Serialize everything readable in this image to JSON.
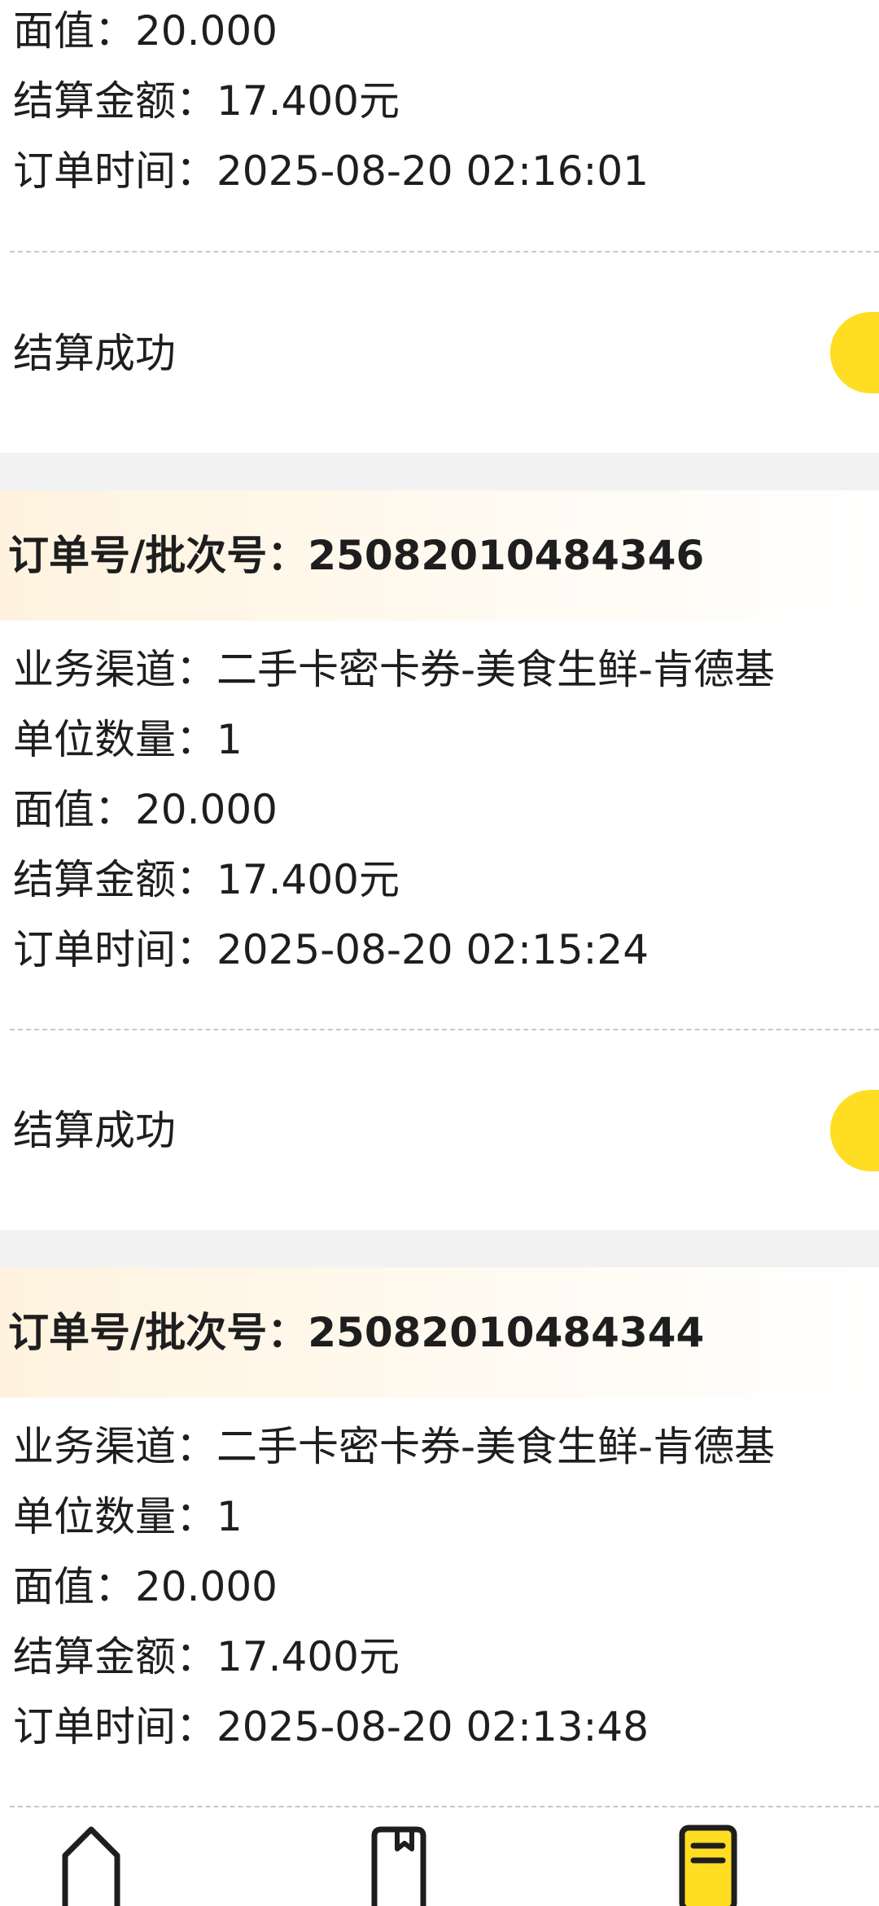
{
  "partial_order": {
    "face_value": "面值：20.000",
    "settle_amount": "结算金额：17.400元",
    "order_time": "订单时间：2025-08-20 02:16:01",
    "status": "结算成功"
  },
  "orders": [
    {
      "header": "订单号/批次号：25082010484346",
      "channel": "业务渠道：二手卡密卡券-美食生鲜-肯德基",
      "quantity": "单位数量：1",
      "face_value": "面值：20.000",
      "settle_amount": "结算金额：17.400元",
      "order_time": "订单时间：2025-08-20 02:15:24",
      "status": "结算成功"
    },
    {
      "header": "订单号/批次号：25082010484344",
      "channel": "业务渠道：二手卡密卡券-美食生鲜-肯德基",
      "quantity": "单位数量：1",
      "face_value": "面值：20.000",
      "settle_amount": "结算金额：17.400元",
      "order_time": "订单时间：2025-08-20 02:13:48"
    }
  ],
  "bottom_nav": {
    "items": [
      {
        "icon": "home-icon"
      },
      {
        "icon": "bookmark-box-icon"
      },
      {
        "icon": "list-icon"
      }
    ],
    "active_color": "#ffdd22"
  },
  "colors": {
    "accent": "#ffdd22",
    "separator": "#f2f2f2"
  }
}
